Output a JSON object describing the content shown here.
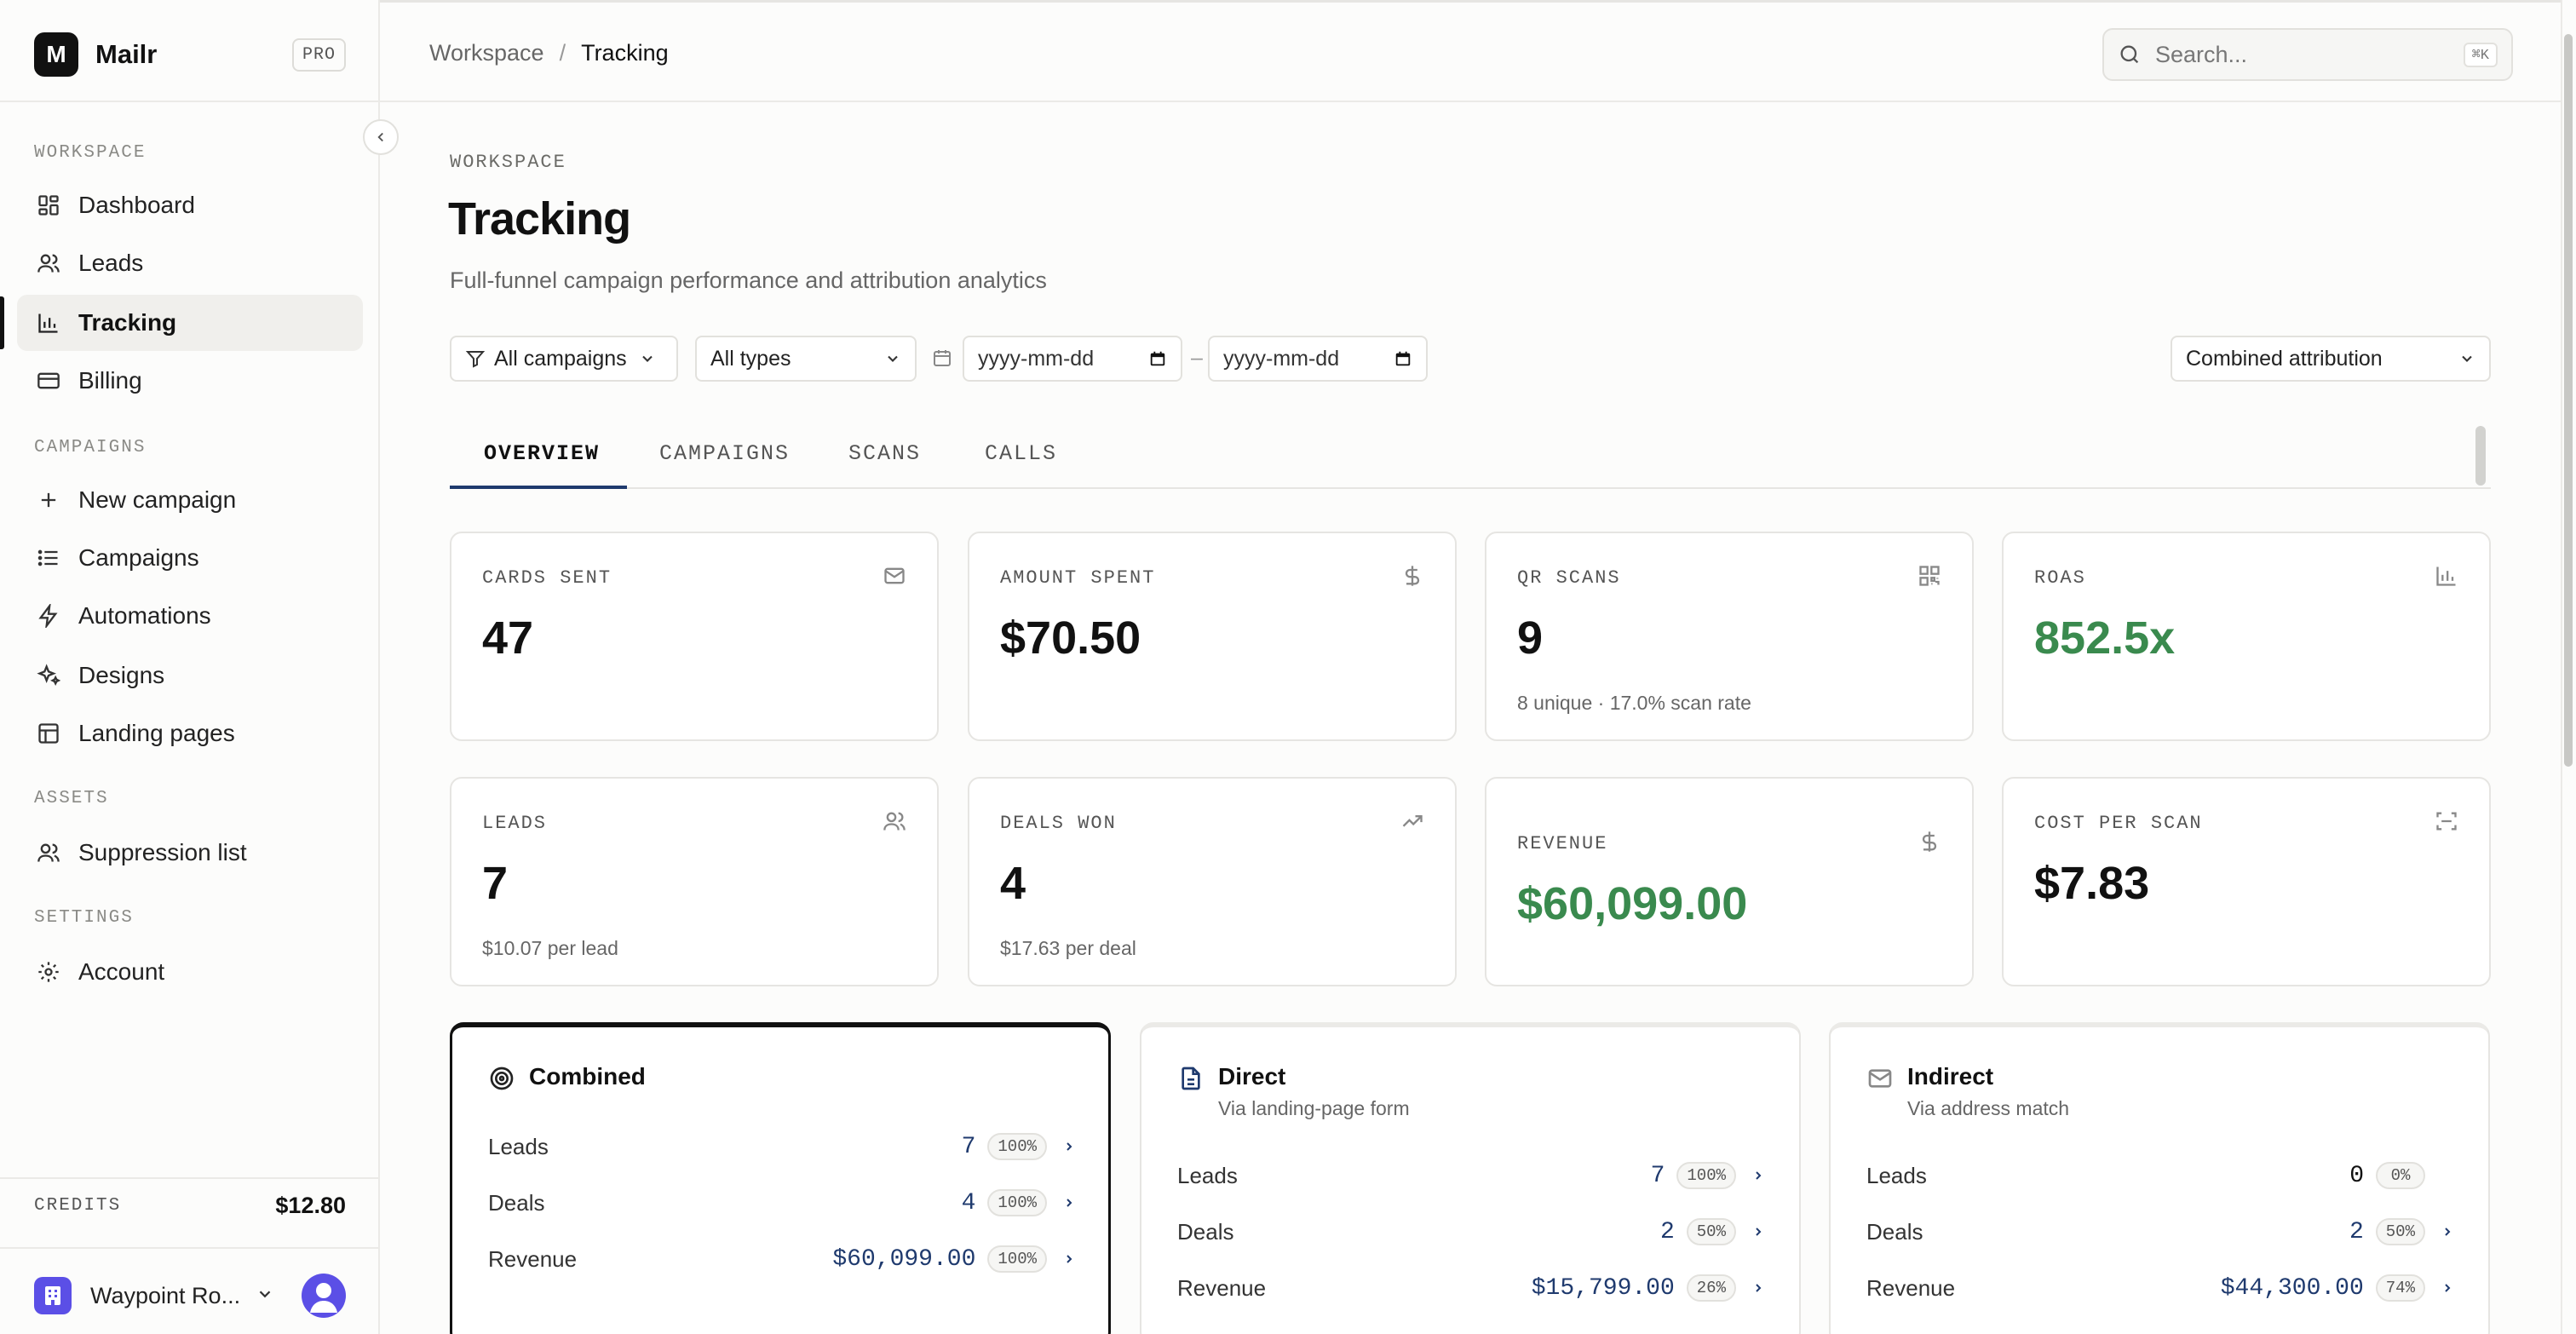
{
  "app": {
    "logo_letter": "M",
    "name": "Mailr",
    "plan_badge": "PRO"
  },
  "sidebar": {
    "sections": [
      {
        "label": "WORKSPACE"
      },
      {
        "label": "CAMPAIGNS"
      },
      {
        "label": "ASSETS"
      },
      {
        "label": "SETTINGS"
      }
    ],
    "items": [
      {
        "label": "Dashboard",
        "icon": "dashboard-icon"
      },
      {
        "label": "Leads",
        "icon": "users-icon"
      },
      {
        "label": "Tracking",
        "icon": "bar-chart-icon",
        "active": true
      },
      {
        "label": "Billing",
        "icon": "credit-card-icon"
      },
      {
        "label": "New campaign",
        "icon": "plus-icon"
      },
      {
        "label": "Campaigns",
        "icon": "list-icon"
      },
      {
        "label": "Automations",
        "icon": "lightning-icon"
      },
      {
        "label": "Designs",
        "icon": "sparkles-icon"
      },
      {
        "label": "Landing pages",
        "icon": "layout-icon"
      },
      {
        "label": "Suppression list",
        "icon": "users-icon"
      },
      {
        "label": "Account",
        "icon": "gear-icon"
      }
    ],
    "credits": {
      "label": "CREDITS",
      "value": "$12.80"
    },
    "org": {
      "name": "Waypoint Ro..."
    }
  },
  "topbar": {
    "breadcrumb": {
      "parent": "Workspace",
      "separator": "/",
      "current": "Tracking"
    },
    "search": {
      "placeholder": "Search...",
      "shortcut": "⌘K"
    }
  },
  "page": {
    "eyebrow": "WORKSPACE",
    "title": "Tracking",
    "subtitle": "Full-funnel campaign performance and attribution analytics"
  },
  "filters": {
    "campaign": "All campaigns",
    "type": "All types",
    "date_from_placeholder": "yyyy-mm-dd",
    "date_separator": "–",
    "date_to_placeholder": "yyyy-mm-dd",
    "attribution": "Combined attribution"
  },
  "tabs": [
    {
      "label": "OVERVIEW",
      "active": true
    },
    {
      "label": "CAMPAIGNS"
    },
    {
      "label": "SCANS"
    },
    {
      "label": "CALLS"
    }
  ],
  "stats": {
    "cards_sent": {
      "label": "CARDS SENT",
      "value": "47",
      "icon": "mail-icon"
    },
    "amount_spent": {
      "label": "AMOUNT SPENT",
      "value": "$70.50",
      "icon": "dollar-icon"
    },
    "qr_scans": {
      "label": "QR SCANS",
      "value": "9",
      "sub": "8 unique · 17.0% scan rate",
      "icon": "qr-code-icon"
    },
    "roas": {
      "label": "ROAS",
      "value": "852.5x",
      "icon": "bar-chart-icon"
    },
    "leads": {
      "label": "LEADS",
      "value": "7",
      "sub": "$10.07 per lead",
      "icon": "users-icon"
    },
    "deals_won": {
      "label": "DEALS WON",
      "value": "4",
      "sub": "$17.63 per deal",
      "icon": "trending-up-icon"
    },
    "revenue": {
      "label": "REVENUE",
      "value": "$60,099.00",
      "icon": "dollar-icon"
    },
    "cost_per_scan": {
      "label": "COST PER SCAN",
      "value": "$7.83",
      "icon": "scan-icon"
    }
  },
  "attribution": {
    "combined": {
      "title": "Combined",
      "rows": [
        {
          "label": "Leads",
          "value": "7",
          "pct": "100%"
        },
        {
          "label": "Deals",
          "value": "4",
          "pct": "100%"
        },
        {
          "label": "Revenue",
          "value": "$60,099.00",
          "pct": "100%"
        }
      ]
    },
    "direct": {
      "title": "Direct",
      "desc": "Via landing-page form",
      "rows": [
        {
          "label": "Leads",
          "value": "7",
          "pct": "100%"
        },
        {
          "label": "Deals",
          "value": "2",
          "pct": "50%"
        },
        {
          "label": "Revenue",
          "value": "$15,799.00",
          "pct": "26%"
        }
      ]
    },
    "indirect": {
      "title": "Indirect",
      "desc": "Via address match",
      "rows": [
        {
          "label": "Leads",
          "value": "0",
          "pct": "0%"
        },
        {
          "label": "Deals",
          "value": "2",
          "pct": "50%"
        },
        {
          "label": "Revenue",
          "value": "$44,300.00",
          "pct": "74%"
        }
      ]
    }
  },
  "colors": {
    "accent_navy": "#1f3a6e",
    "positive_green": "#3a8a4e",
    "brand_purple": "#5b4fe6"
  }
}
